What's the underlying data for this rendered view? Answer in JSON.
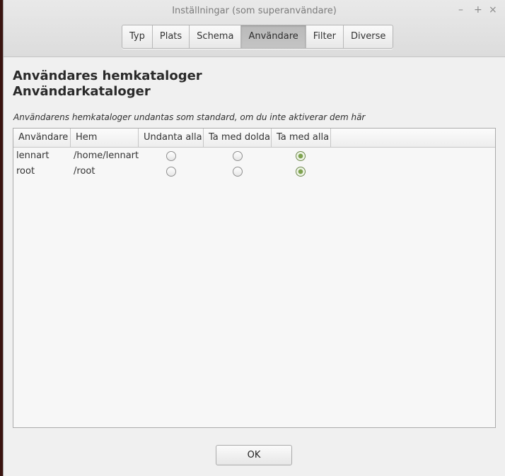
{
  "window": {
    "title": "Inställningar (som superanvändare)",
    "controls": {
      "minimize": "–",
      "maximize": "+",
      "close": "×"
    }
  },
  "tabs": [
    {
      "label": "Typ",
      "active": false
    },
    {
      "label": "Plats",
      "active": false
    },
    {
      "label": "Schema",
      "active": false
    },
    {
      "label": "Användare",
      "active": true
    },
    {
      "label": "Filter",
      "active": false
    },
    {
      "label": "Diverse",
      "active": false
    }
  ],
  "section": {
    "heading1": "Användares hemkataloger",
    "heading2": "Användarkataloger",
    "description": "Användarens hemkataloger undantas som standard, om du inte aktiverar dem här"
  },
  "table": {
    "columns": [
      "Användare",
      "Hem",
      "Undanta alla",
      "Ta med dolda",
      "Ta med alla"
    ],
    "rows": [
      {
        "user": "lennart",
        "home": "/home/lennart",
        "selected": "Ta med alla"
      },
      {
        "user": "root",
        "home": "/root",
        "selected": "Ta med alla"
      }
    ]
  },
  "buttons": {
    "ok": "OK"
  },
  "colors": {
    "radio_checked": "#7ea24f",
    "active_tab": "#bdbdbd"
  }
}
